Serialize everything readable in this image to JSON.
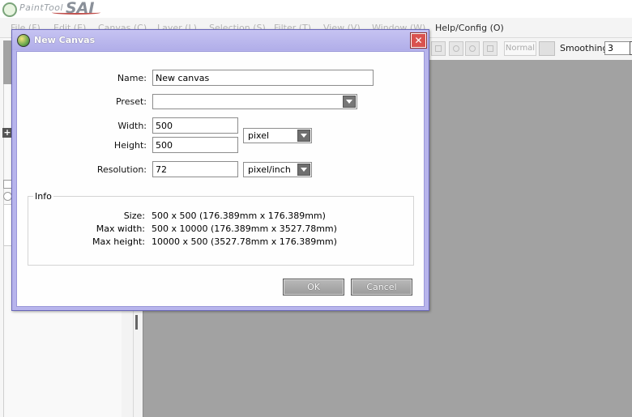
{
  "app": {
    "name_prefix": "PaintTool",
    "name": "SAI"
  },
  "menubar": [
    {
      "label": "File (F)"
    },
    {
      "label": "Edit (E)"
    },
    {
      "label": "Canvas (C)"
    },
    {
      "label": "Layer (L)"
    },
    {
      "label": "Selection (S)"
    },
    {
      "label": "Filter (T)"
    },
    {
      "label": "View (V)"
    },
    {
      "label": "Window (W)"
    },
    {
      "label": "Help/Config (O)"
    }
  ],
  "toolbar": {
    "blend_mode": "Normal",
    "smoothing_label": "Smoothing",
    "smoothing_value": "3"
  },
  "dialog": {
    "title": "New Canvas",
    "close_glyph": "✕",
    "name_label": "Name:",
    "name_value": "New canvas",
    "preset_label": "Preset:",
    "preset_value": "",
    "width_label": "Width:",
    "width_value": "500",
    "height_label": "Height:",
    "height_value": "500",
    "size_unit": "pixel",
    "resolution_label": "Resolution:",
    "resolution_value": "72",
    "resolution_unit": "pixel/inch",
    "info": {
      "legend": "Info",
      "size_label": "Size:",
      "size_value": "500 x 500 (176.389mm x 176.389mm)",
      "max_width_label": "Max width:",
      "max_width_value": "500 x 10000 (176.389mm x 3527.78mm)",
      "max_height_label": "Max height:",
      "max_height_value": "10000 x 500 (3527.78mm x 176.389mm)"
    },
    "ok_label": "OK",
    "cancel_label": "Cancel"
  },
  "colors": {
    "dialog_frame": "#b7b4ec",
    "canvas_bg": "#a2a2a2",
    "close_button": "#d9534f"
  }
}
